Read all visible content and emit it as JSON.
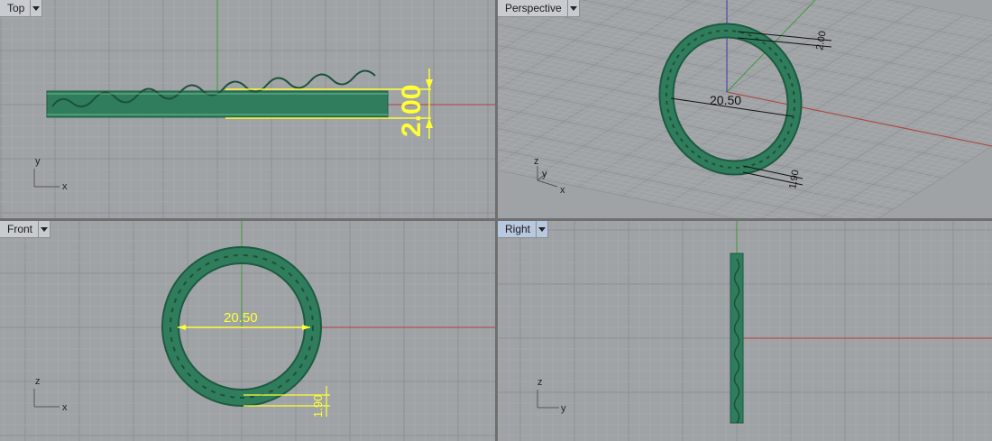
{
  "viewports": {
    "top": {
      "title": "Top",
      "dim_height": "2.00",
      "axis_labels": [
        "y",
        "x"
      ]
    },
    "perspective": {
      "title": "Perspective",
      "dim_diameter": "20.50",
      "dim_width": "2.00",
      "dim_thickness": "1.90",
      "axis_labels": [
        "z",
        "y",
        "x"
      ]
    },
    "front": {
      "title": "Front",
      "dim_diameter": "20.50",
      "dim_thickness": "1.90",
      "axis_labels": [
        "z",
        "x"
      ]
    },
    "right": {
      "title": "Right",
      "axis_labels": [
        "z",
        "y"
      ]
    }
  },
  "colors": {
    "viewport_bg": "#9fa3a6",
    "grid_minor": "#a9adb0",
    "grid_major": "#8d9195",
    "x_axis": "#b0413e",
    "y_axis": "#3f9a3a",
    "z_axis": "#3a3aa6",
    "ring": "#2f7d5c",
    "dimension_highlight": "#ffff33",
    "active_tab": "#b8c8de"
  }
}
